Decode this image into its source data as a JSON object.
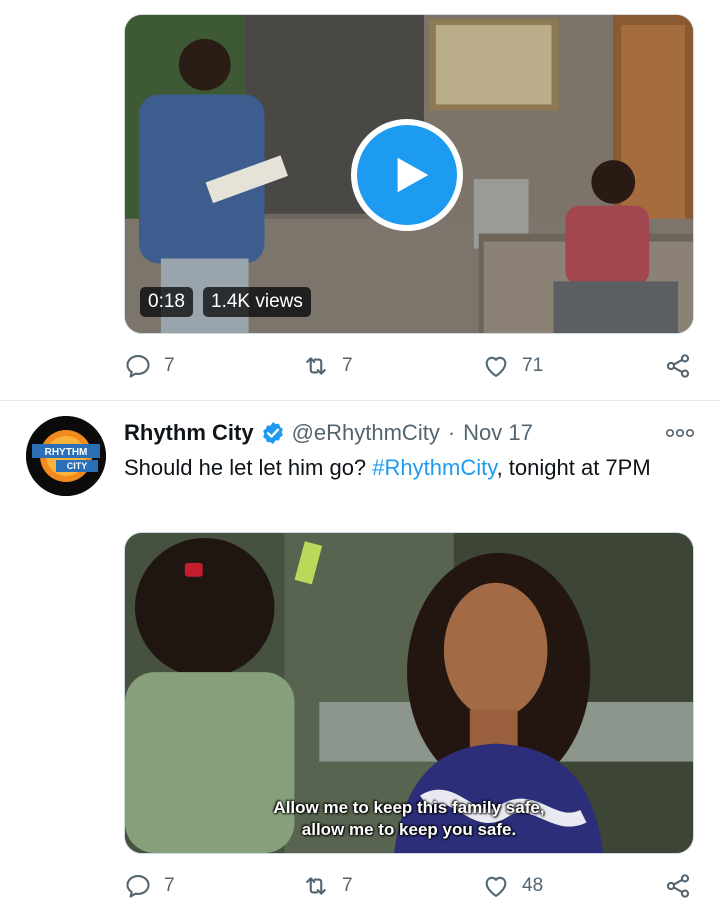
{
  "tweet1": {
    "video": {
      "duration": "0:18",
      "views": "1.4K views"
    },
    "actions": {
      "replies": "7",
      "retweets": "7",
      "likes": "71"
    }
  },
  "tweet2": {
    "author": {
      "name": "Rhythm City",
      "handle": "@eRhythmCity",
      "separator": "·",
      "date": "Nov 17",
      "avatar_text_top": "RHYTHM",
      "avatar_text_bottom": "CITY"
    },
    "text": {
      "before": "Should he let let him go? ",
      "hashtag": "#RhythmCity",
      "after": ", tonight at 7PM"
    },
    "subtitles": {
      "line1": "Allow me to keep this family safe,",
      "line2": "allow me to keep you safe."
    },
    "actions": {
      "replies": "7",
      "retweets": "7",
      "likes": "48"
    }
  },
  "colors": {
    "accent": "#1d9bf0",
    "secondary_text": "#536471",
    "divider": "#e6e9ec"
  },
  "icons": [
    "reply-icon",
    "retweet-icon",
    "like-icon",
    "share-icon",
    "play-icon",
    "verified-icon",
    "more-icon",
    "channel-logo-icon"
  ]
}
